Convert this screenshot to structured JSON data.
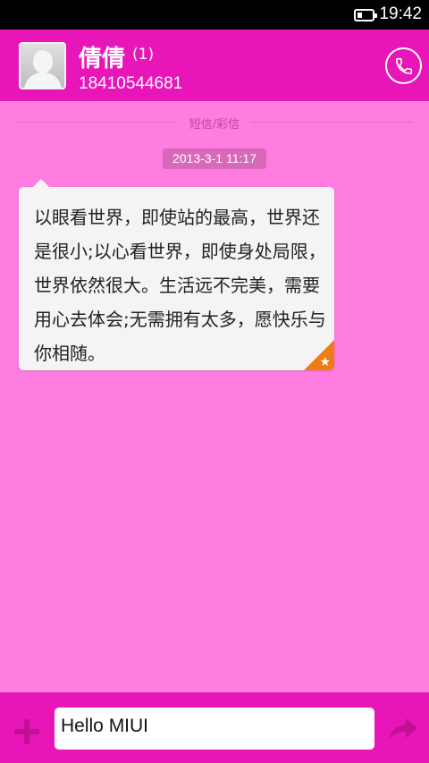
{
  "status_bar": {
    "time": "19:42",
    "battery_icon": "battery-icon"
  },
  "header": {
    "contact_name": "倩倩",
    "message_count": "(1)",
    "phone_number": "18410544681",
    "avatar_icon": "default-avatar-icon",
    "call_icon": "phone-call-icon"
  },
  "conversation": {
    "divider_label": "短信/彩信",
    "date": "2013-3-1 11:17",
    "messages": [
      {
        "text": "以眼看世界，即使站的最高，世界还是很小;以心看世界，即使身处局限，世界依然很大。生活远不完美，需要用心去体会;无需拥有太多，愿快乐与你相随。",
        "starred": true
      }
    ]
  },
  "composer": {
    "input_value": "Hello MIUI",
    "add_icon": "plus-icon",
    "send_icon": "send-arrow-icon"
  },
  "colors": {
    "header_bg": "#e815b9",
    "background": "#ff7ce0",
    "star_badge": "#f07a17"
  }
}
